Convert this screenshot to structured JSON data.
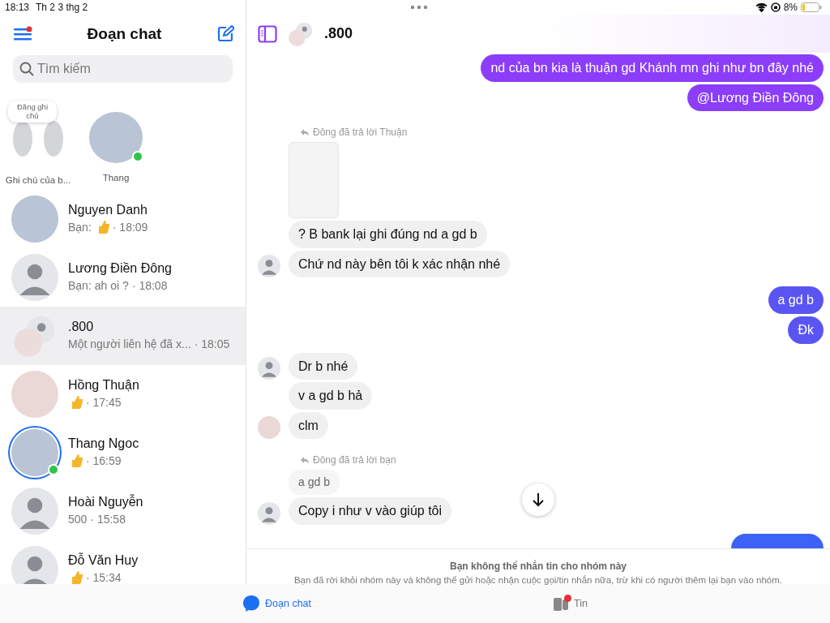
{
  "status_bar": {
    "time": "18:13",
    "date": "Th 2 3 thg 2",
    "battery": "8%"
  },
  "sidebar": {
    "title": "Đoạn chat",
    "search": {
      "placeholder": "Tìm kiếm"
    },
    "notes": [
      {
        "kind": "own",
        "bubble": "Đăng ghi chú",
        "label": "Ghi chú của b...",
        "online": false
      },
      {
        "kind": "picture",
        "label": "Thang",
        "online": true
      }
    ],
    "conversations": [
      {
        "name": "Nguyen Danh",
        "prefix": "Bạn:",
        "like": true,
        "time": "· 18:09",
        "avatar": {
          "kind": "picture"
        },
        "online": false,
        "ring": false,
        "selected": false
      },
      {
        "name": "Lương Điền Đông",
        "prefix": "Bạn:",
        "preview": "ah oi ?",
        "like": false,
        "time": "· 18:08",
        "avatar": {
          "kind": "placeholder"
        },
        "online": false,
        "ring": false,
        "selected": false
      },
      {
        "name": ".800",
        "preview": "Một người liên hệ đã x...",
        "like": false,
        "time": "· 18:05",
        "avatar": {
          "kind": "group"
        },
        "online": false,
        "ring": false,
        "selected": true
      },
      {
        "name": "Hồng Thuận",
        "like": true,
        "time": "· 17:45",
        "avatar": {
          "kind": "picture"
        },
        "online": false,
        "ring": false,
        "selected": false
      },
      {
        "name": "Thang Ngoc",
        "like": true,
        "time": "· 16:59",
        "avatar": {
          "kind": "picture"
        },
        "online": true,
        "ring": true,
        "selected": false
      },
      {
        "name": "Hoài Nguyễn",
        "preview": "500",
        "like": false,
        "time": "· 15:58",
        "avatar": {
          "kind": "placeholder"
        },
        "online": false,
        "ring": false,
        "selected": false
      },
      {
        "name": "Đỗ Văn Huy",
        "like": true,
        "time": "· 15:34",
        "avatar": {
          "kind": "placeholder"
        },
        "online": false,
        "ring": false,
        "selected": false
      }
    ]
  },
  "chat": {
    "title": ".800",
    "messages": [
      {
        "kind": "outgoing",
        "text": "nd của bn kia là thuận gd Khánh mn ghi như bn đây nhé",
        "color": "#8b3dfa"
      },
      {
        "kind": "outgoing",
        "text": "@Lương Điền Đông",
        "color": "#8b3dfa"
      },
      {
        "kind": "reply_note",
        "text": "Đông đã trả lời Thuận"
      },
      {
        "kind": "image"
      },
      {
        "kind": "incoming",
        "text": "? B bank lại ghi đúng nd a gd b"
      },
      {
        "kind": "incoming",
        "text": "Chứ nd này bên tôi k xác nhận nhé",
        "avatar": {
          "kind": "placeholder"
        }
      },
      {
        "kind": "outgoing",
        "text": "a gd b",
        "color": "#5a55f2"
      },
      {
        "kind": "outgoing",
        "text": "Đk",
        "color": "#5a55f2"
      },
      {
        "kind": "incoming",
        "text": "Dr b nhé",
        "avatar": {
          "kind": "placeholder"
        }
      },
      {
        "kind": "incoming",
        "text": "v a gd b hả"
      },
      {
        "kind": "incoming",
        "text": "clm",
        "avatar": {
          "kind": "picture"
        }
      },
      {
        "kind": "reply_note",
        "text": "Đông đã trả lời bạn"
      },
      {
        "kind": "quote",
        "text": "a gd b"
      },
      {
        "kind": "incoming",
        "text": "Copy i như v vào giúp tôi",
        "avatar": {
          "kind": "placeholder"
        }
      },
      {
        "kind": "outgoing_partial",
        "color": "#3d63f5"
      }
    ],
    "notice": {
      "title": "Bạn không thể nhắn tin cho nhóm này",
      "body": "Bạn đã rời khỏi nhóm này và không thể gửi hoặc nhận cuộc gọi/tin nhắn nữa, trừ khi có người thêm lại bạn vào nhóm."
    }
  },
  "tab_bar": [
    {
      "label": "Đoạn chat",
      "selected": true,
      "badge": false
    },
    {
      "label": "Tin",
      "selected": false,
      "badge": true
    }
  ]
}
